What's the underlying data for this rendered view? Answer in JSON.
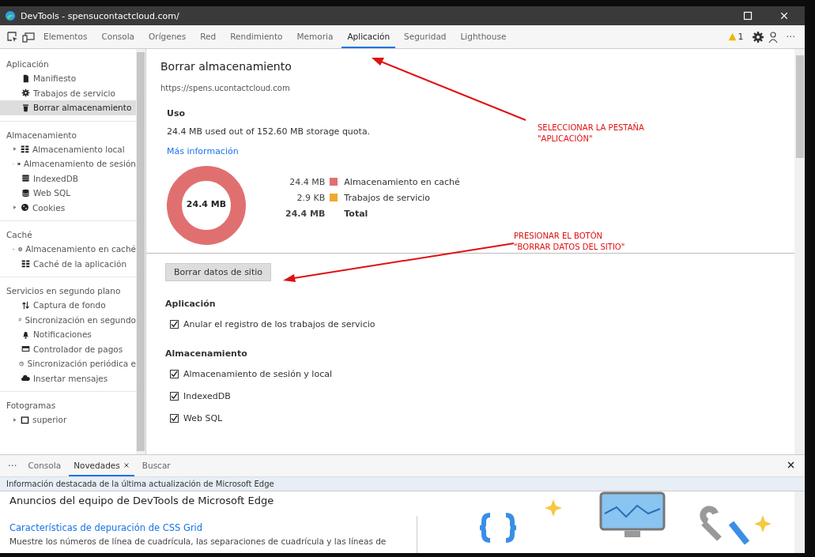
{
  "window": {
    "title": "DevTools - spensucontactcloud.com/"
  },
  "tabs": [
    {
      "label": "Elementos",
      "selected": false
    },
    {
      "label": "Consola",
      "selected": false
    },
    {
      "label": "Orígenes",
      "selected": false
    },
    {
      "label": "Red",
      "selected": false
    },
    {
      "label": "Rendimiento",
      "selected": false
    },
    {
      "label": "Memoria",
      "selected": false
    },
    {
      "label": "Aplicación",
      "selected": true
    },
    {
      "label": "Seguridad",
      "selected": false
    },
    {
      "label": "Lighthouse",
      "selected": false
    }
  ],
  "toolbar": {
    "warning_count": "1",
    "more": "···"
  },
  "sidebar": {
    "sections": [
      {
        "title": "Aplicación",
        "items": [
          {
            "label": "Manifiesto",
            "expandable": false,
            "selected": false
          },
          {
            "label": "Trabajos de servicio",
            "expandable": false,
            "selected": false
          },
          {
            "label": "Borrar almacenamiento",
            "expandable": false,
            "selected": true
          }
        ]
      },
      {
        "title": "Almacenamiento",
        "items": [
          {
            "label": "Almacenamiento local",
            "expandable": true,
            "selected": false
          },
          {
            "label": "Almacenamiento de sesión",
            "expandable": true,
            "selected": false
          },
          {
            "label": "IndexedDB",
            "expandable": false,
            "selected": false
          },
          {
            "label": "Web SQL",
            "expandable": false,
            "selected": false
          },
          {
            "label": "Cookies",
            "expandable": true,
            "selected": false
          }
        ]
      },
      {
        "title": "Caché",
        "items": [
          {
            "label": "Almacenamiento en caché",
            "expandable": true,
            "selected": false
          },
          {
            "label": "Caché de la aplicación",
            "expandable": false,
            "selected": false
          }
        ]
      },
      {
        "title": "Servicios en segundo plano",
        "items": [
          {
            "label": "Captura de fondo",
            "expandable": false,
            "selected": false
          },
          {
            "label": "Sincronización en segundo",
            "expandable": false,
            "selected": false
          },
          {
            "label": "Notificaciones",
            "expandable": false,
            "selected": false
          },
          {
            "label": "Controlador de pagos",
            "expandable": false,
            "selected": false
          },
          {
            "label": "Sincronización periódica e",
            "expandable": false,
            "selected": false
          },
          {
            "label": "Insertar mensajes",
            "expandable": false,
            "selected": false
          }
        ]
      },
      {
        "title": "Fotogramas",
        "items": [
          {
            "label": "superior",
            "expandable": true,
            "selected": false
          }
        ]
      }
    ]
  },
  "main": {
    "title": "Borrar almacenamiento",
    "origin": "https://spens.ucontactcloud.com",
    "usage": {
      "heading": "Uso",
      "summary": "24.4 MB used out of 152.60 MB storage quota.",
      "link": "Más información",
      "center_label": "24.4 MB",
      "legend": [
        {
          "value": "24.4 MB",
          "label": "Almacenamiento en caché",
          "color": "#e07070"
        },
        {
          "value": "2.9 KB",
          "label": "Trabajos de servicio",
          "color": "#f0a830"
        }
      ],
      "total": {
        "value": "24.4 MB",
        "label": "Total"
      }
    },
    "clear_button": "Borrar datos de sitio",
    "groups": [
      {
        "heading": "Aplicación",
        "options": [
          {
            "label": "Anular el registro de los trabajos de servicio",
            "checked": true
          }
        ]
      },
      {
        "heading": "Almacenamiento",
        "options": [
          {
            "label": "Almacenamiento de sesión y local",
            "checked": true
          },
          {
            "label": "IndexedDB",
            "checked": true
          },
          {
            "label": "Web SQL",
            "checked": true
          }
        ]
      }
    ]
  },
  "drawer": {
    "more": "···",
    "tabs": [
      {
        "label": "Consola",
        "selected": false,
        "closable": false
      },
      {
        "label": "Novedades",
        "selected": true,
        "closable": true
      },
      {
        "label": "Buscar",
        "selected": false,
        "closable": false
      }
    ],
    "banner": "Información destacada de la última actualización de Microsoft Edge",
    "heading": "Anuncios del equipo de DevTools de Microsoft Edge",
    "card": {
      "title": "Características de depuración de CSS Grid",
      "text": "Muestre los números de línea de cuadrícula, las separaciones de cuadrícula y las líneas de"
    }
  },
  "annotations": [
    {
      "lines": [
        "SELECCIONAR LA PESTAÑA",
        "\"APLICACIÓN\""
      ]
    },
    {
      "lines": [
        "PRESIONAR EL BOTÓN",
        "\"BORRAR DATOS DEL SITIO\""
      ]
    }
  ]
}
